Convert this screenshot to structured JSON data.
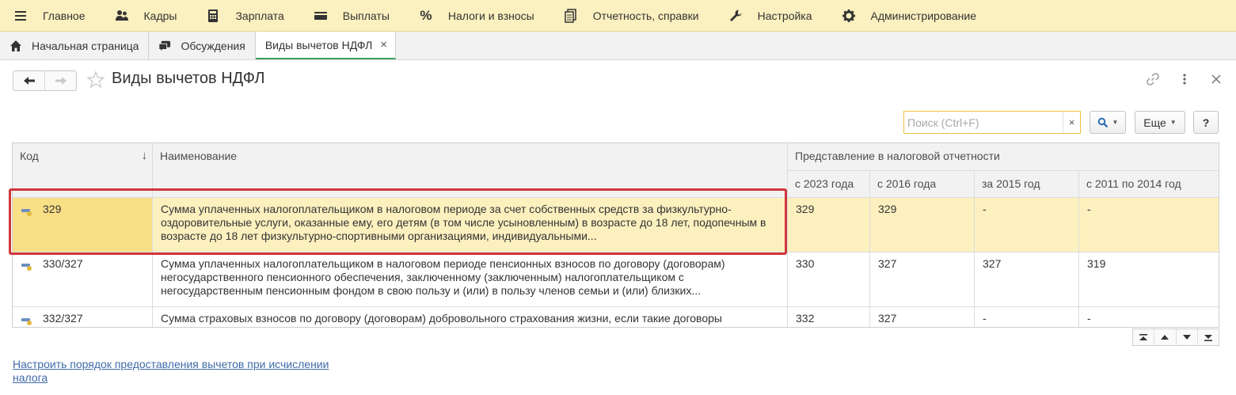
{
  "menu": {
    "items": [
      {
        "label": "Главное",
        "icon": "hamburger-icon"
      },
      {
        "label": "Кадры",
        "icon": "users-icon"
      },
      {
        "label": "Зарплата",
        "icon": "calculator-icon"
      },
      {
        "label": "Выплаты",
        "icon": "wallet-icon"
      },
      {
        "label": "Налоги и взносы",
        "icon": "percent-icon"
      },
      {
        "label": "Отчетность, справки",
        "icon": "documents-icon"
      },
      {
        "label": "Настройка",
        "icon": "wrench-icon"
      },
      {
        "label": "Администрирование",
        "icon": "gear-icon"
      }
    ]
  },
  "tabs": {
    "home": "Начальная страница",
    "discussions": "Обсуждения",
    "current": "Виды вычетов НДФЛ",
    "close": "×"
  },
  "header": {
    "title": "Виды вычетов НДФЛ"
  },
  "toolbar": {
    "search_placeholder": "Поиск (Ctrl+F)",
    "search_clear": "×",
    "more_label": "Еще",
    "help_label": "?"
  },
  "table": {
    "headers": {
      "code": "Код",
      "name": "Наименование",
      "group": "Представление в налоговой отчетности",
      "y2023": "с 2023 года",
      "y2016": "с 2016 года",
      "y2015": "за 2015 год",
      "y2011": "с 2011 по 2014  год",
      "sort_arrow": "↓"
    },
    "rows": [
      {
        "code": "329",
        "name": "Сумма уплаченных налогоплательщиком в налоговом периоде за счет собственных средств за физкультурно-оздоровительные услуги, оказанные ему, его детям (в том числе усыновленным) в возрасте до 18 лет, подопечным в возрасте до 18 лет физкультурно-спортивными организациями, индивидуальными...",
        "y2023": "329",
        "y2016": "329",
        "y2015": "-",
        "y2011": "-"
      },
      {
        "code": "330/327",
        "name": "Сумма уплаченных налогоплательщиком в налоговом периоде пенсионных взносов по договору (договорам) негосударственного пенсионного обеспечения, заключенному (заключенным) налогоплательщиком с негосударственным пенсионным фондом в свою пользу и (или) в пользу членов семьи и (или) близких...",
        "y2023": "330",
        "y2016": "327",
        "y2015": "327",
        "y2011": "319"
      },
      {
        "code": "332/327",
        "name": "Сумма страховых взносов по договору (договорам) добровольного страхования жизни, если такие договоры",
        "y2023": "332",
        "y2016": "327",
        "y2015": "-",
        "y2011": "-"
      }
    ]
  },
  "footer": {
    "link": "Настроить порядок предоставления вычетов при исчислении налога"
  },
  "colors": {
    "menu_bg": "#fbf0bf",
    "selected_row": "#fcf0bf",
    "selected_cell": "#f9df86",
    "highlight_border": "#d0363c",
    "link": "#3f6ba8",
    "search_border": "#f0c23c"
  }
}
